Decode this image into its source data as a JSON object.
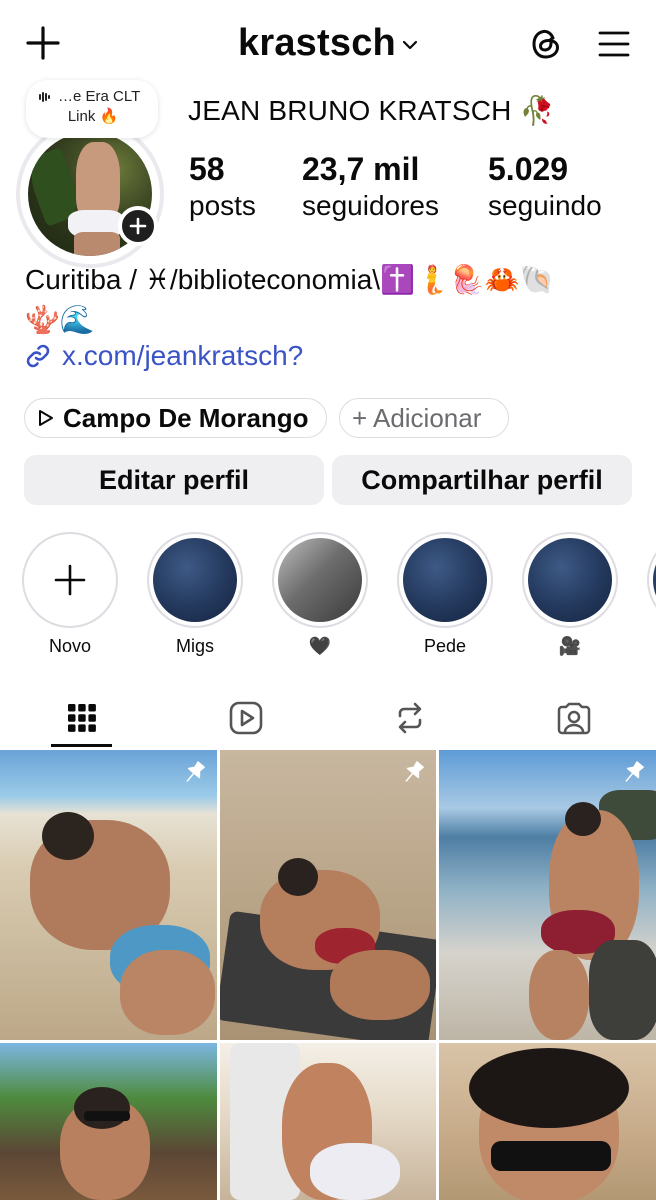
{
  "header": {
    "username": "krastsch"
  },
  "profile": {
    "full_name": "JEAN BRUNO KRATSCH 🥀",
    "note_line1": "…e Era CLT",
    "note_line2": "Link 🔥",
    "stats": [
      {
        "value": "58",
        "label": "posts"
      },
      {
        "value": "23,7 mil",
        "label": "seguidores"
      },
      {
        "value": "5.029",
        "label": "seguindo"
      }
    ],
    "bio_line1": "Curitiba / ♓/biblioteconomia\\✝️🧜🪼🦀🐚",
    "bio_line2": "🪸🌊",
    "link": "x.com/jeankratsch?",
    "music_pill": "Campo De Morango",
    "add_pill": "+ Adicionar",
    "edit_button": "Editar perfil",
    "share_button": "Compartilhar perfil"
  },
  "highlights": [
    {
      "label": "Novo",
      "kind": "new"
    },
    {
      "label": "Migs",
      "kind": "ocean"
    },
    {
      "label": "🖤",
      "kind": "collage"
    },
    {
      "label": "Pede",
      "kind": "ocean"
    },
    {
      "label": "🎥",
      "kind": "ocean"
    }
  ],
  "tabs": [
    {
      "name": "grid",
      "active": true
    },
    {
      "name": "reels",
      "active": false
    },
    {
      "name": "reposts",
      "active": false
    },
    {
      "name": "tagged",
      "active": false
    }
  ],
  "posts": [
    {
      "pinned": true
    },
    {
      "pinned": true
    },
    {
      "pinned": true
    },
    {
      "pinned": false
    },
    {
      "pinned": false
    },
    {
      "pinned": false
    }
  ]
}
